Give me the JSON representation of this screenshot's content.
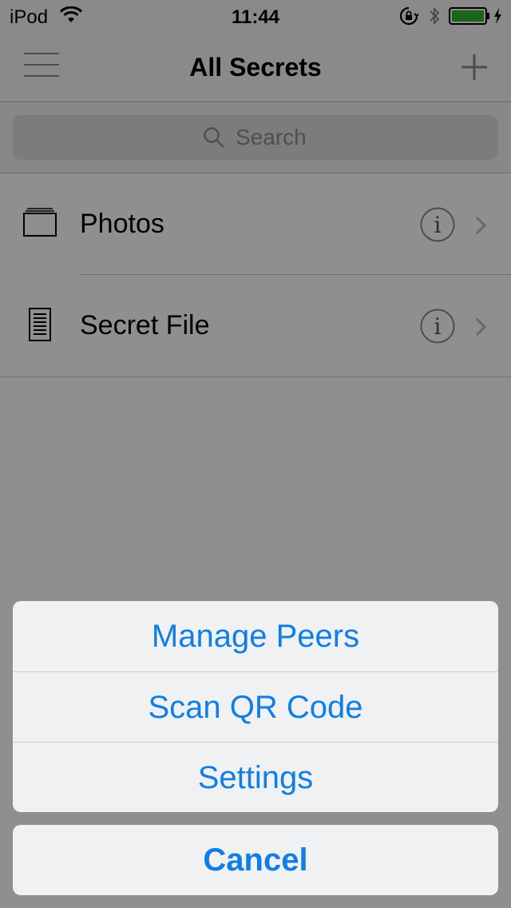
{
  "status_bar": {
    "carrier": "iPod",
    "time": "11:44",
    "battery_color": "#33b535"
  },
  "nav": {
    "title": "All Secrets",
    "left_icon": "menu-icon",
    "right_icon": "plus-icon"
  },
  "search": {
    "placeholder": "Search"
  },
  "list": {
    "items": [
      {
        "label": "Photos",
        "icon": "folder-icon"
      },
      {
        "label": "Secret File",
        "icon": "document-icon"
      }
    ]
  },
  "action_sheet": {
    "options": [
      {
        "label": "Manage Peers"
      },
      {
        "label": "Scan QR Code"
      },
      {
        "label": "Settings"
      }
    ],
    "cancel_label": "Cancel",
    "accent_color": "#117ee6"
  }
}
